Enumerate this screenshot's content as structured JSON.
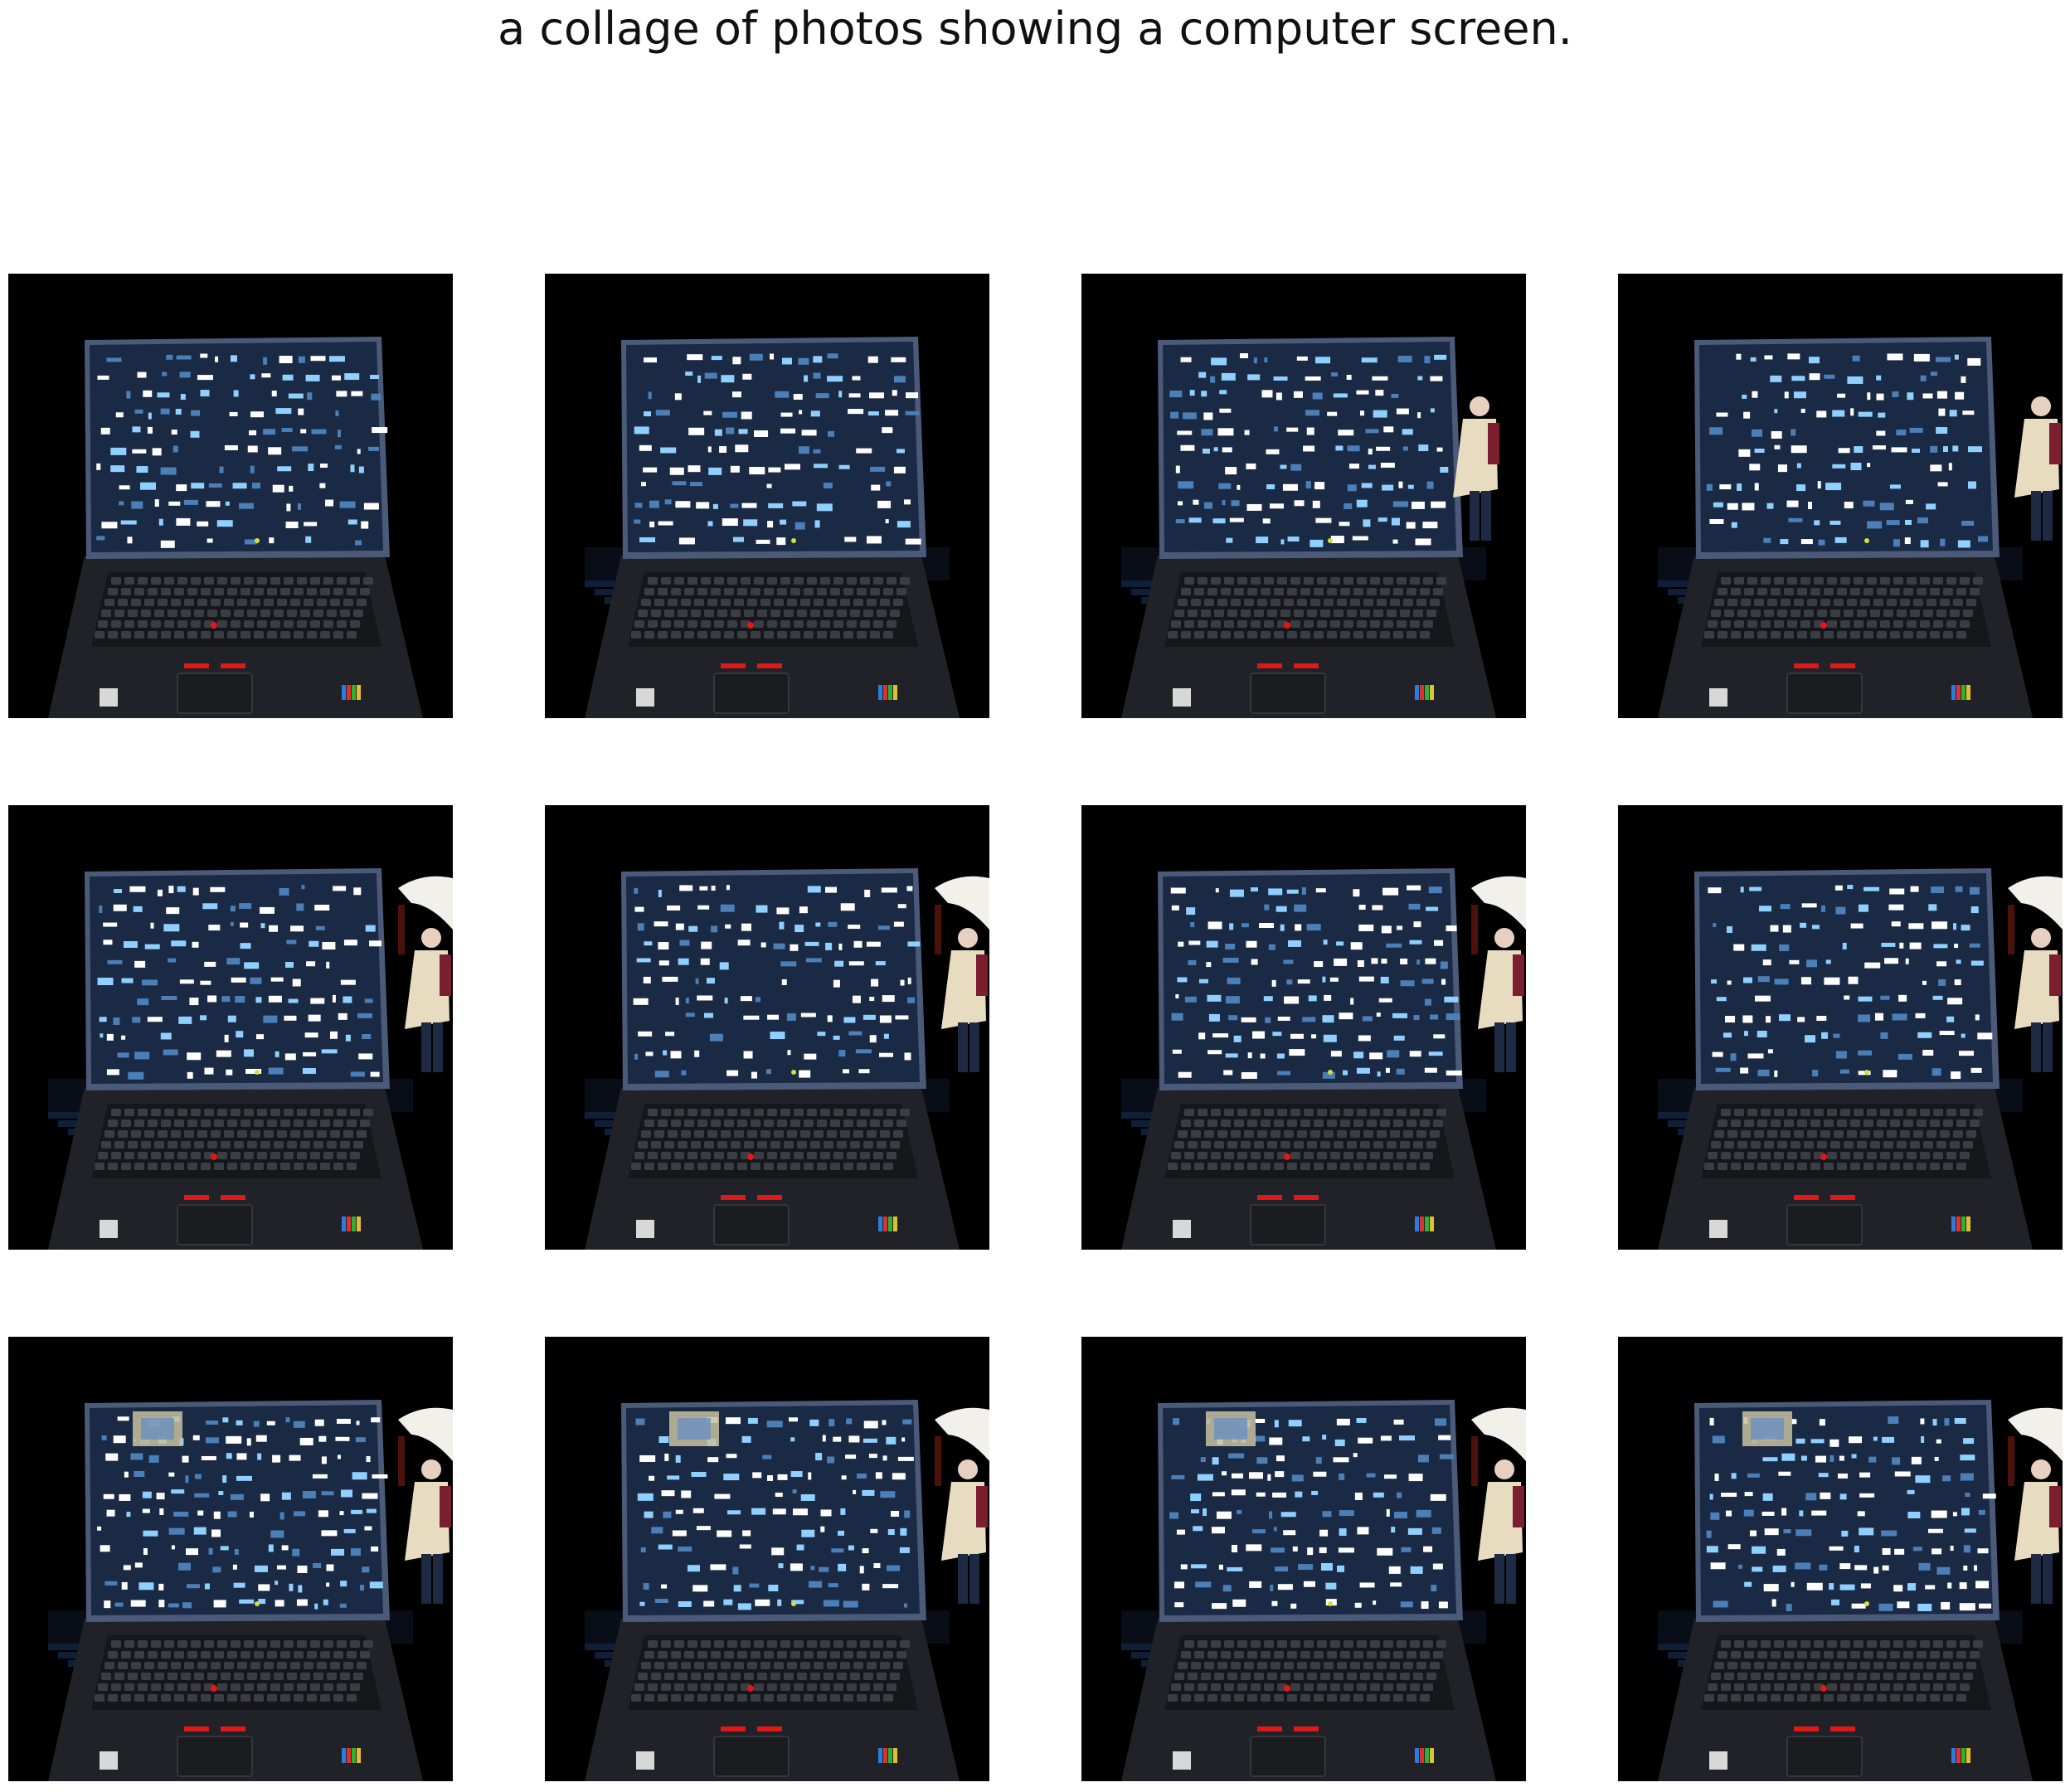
{
  "title": "a collage of photos showing a computer screen.",
  "grid": {
    "rows": 3,
    "cols": 4
  },
  "palette": {
    "background": "#000000",
    "screen": "#1b2a44",
    "screen_glow": "#8fd0ff",
    "bezel": "#4a5a78",
    "body": "#202227",
    "keys": "#3a3d44",
    "trackpoint": "#e01818",
    "coat": "#e8dcc0",
    "sleeve": "#f2f0ea"
  },
  "tiles": [
    {
      "person": false,
      "ghost_keys": false,
      "sleeve": false,
      "sticker": false
    },
    {
      "person": false,
      "ghost_keys": true,
      "sleeve": false,
      "sticker": false
    },
    {
      "person": true,
      "ghost_keys": true,
      "sleeve": false,
      "sticker": false
    },
    {
      "person": true,
      "ghost_keys": true,
      "sleeve": false,
      "sticker": false
    },
    {
      "person": true,
      "ghost_keys": true,
      "sleeve": true,
      "sticker": false
    },
    {
      "person": true,
      "ghost_keys": true,
      "sleeve": true,
      "sticker": false
    },
    {
      "person": true,
      "ghost_keys": true,
      "sleeve": true,
      "sticker": false
    },
    {
      "person": true,
      "ghost_keys": true,
      "sleeve": true,
      "sticker": false
    },
    {
      "person": true,
      "ghost_keys": true,
      "sleeve": true,
      "sticker": true
    },
    {
      "person": true,
      "ghost_keys": true,
      "sleeve": true,
      "sticker": true
    },
    {
      "person": true,
      "ghost_keys": true,
      "sleeve": true,
      "sticker": true
    },
    {
      "person": true,
      "ghost_keys": true,
      "sleeve": true,
      "sticker": true
    }
  ]
}
